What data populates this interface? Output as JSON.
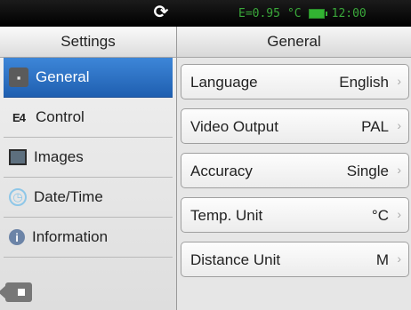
{
  "statusbar": {
    "refresh_icon": "refresh-icon",
    "emissivity": "E=0.95",
    "unit": "°C",
    "battery_icon": "battery-icon",
    "time": "12:00"
  },
  "sidebar": {
    "title": "Settings",
    "items": [
      {
        "label": "General",
        "icon": "general-icon",
        "active": true
      },
      {
        "label": "Control",
        "icon": "control-icon",
        "active": false
      },
      {
        "label": "Images",
        "icon": "images-icon",
        "active": false
      },
      {
        "label": "Date/Time",
        "icon": "clock-icon",
        "active": false
      },
      {
        "label": "Information",
        "icon": "info-icon",
        "active": false
      }
    ],
    "back_icon": "back-arrow-icon"
  },
  "main": {
    "title": "General",
    "rows": [
      {
        "label": "Language",
        "value": "English"
      },
      {
        "label": "Video Output",
        "value": "PAL"
      },
      {
        "label": "Accuracy",
        "value": "Single"
      },
      {
        "label": "Temp. Unit",
        "value": "°C"
      },
      {
        "label": "Distance Unit",
        "value": "M"
      }
    ]
  },
  "colors": {
    "active_item": "#2f73c6",
    "status_text": "#3aa83a"
  }
}
